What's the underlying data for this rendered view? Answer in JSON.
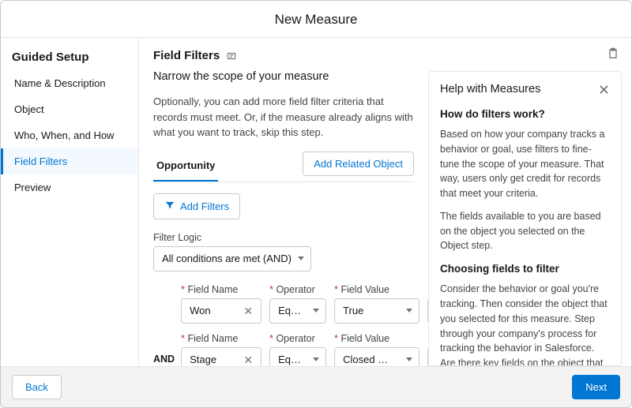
{
  "header": {
    "title": "New Measure"
  },
  "sidebar": {
    "title": "Guided Setup",
    "items": [
      {
        "label": "Name & Description"
      },
      {
        "label": "Object"
      },
      {
        "label": "Who, When, and How"
      },
      {
        "label": "Field Filters"
      },
      {
        "label": "Preview"
      }
    ]
  },
  "content": {
    "title": "Field Filters",
    "subtitle": "Narrow the scope of your measure",
    "description": "Optionally, you can add more field filter criteria that records must meet. Or, if the measure already aligns with what you want to track, skip this step.",
    "tab_label": "Opportunity",
    "add_related_object": "Add Related Object",
    "add_filters": "Add Filters",
    "filter_logic_label": "Filter Logic",
    "filter_logic_value": "All conditions are met (AND)",
    "and_label": "AND",
    "labels": {
      "field_name": "Field Name",
      "operator": "Operator",
      "field_value": "Field Value"
    },
    "rows": [
      {
        "field_name": "Won",
        "operator": "Eq…",
        "field_value": "True"
      },
      {
        "field_name": "Stage",
        "operator": "Eq…",
        "field_value": "Closed …"
      }
    ]
  },
  "help": {
    "title": "Help with Measures",
    "h1": "How do filters work?",
    "p1": "Based on how your company tracks a behavior or goal, use filters to fine-tune the scope of your measure. That way, users only get credit for records that meet your criteria.",
    "p2": "The fields available to you are based on the object you selected on the Object step.",
    "h2": "Choosing fields to filter",
    "p3": "Consider the behavior or goal you're tracking. Then consider the object that you selected for this measure. Step through your company's process for tracking the behavior in Salesforce. Are there key fields on the object that your"
  },
  "footer": {
    "back": "Back",
    "next": "Next"
  }
}
